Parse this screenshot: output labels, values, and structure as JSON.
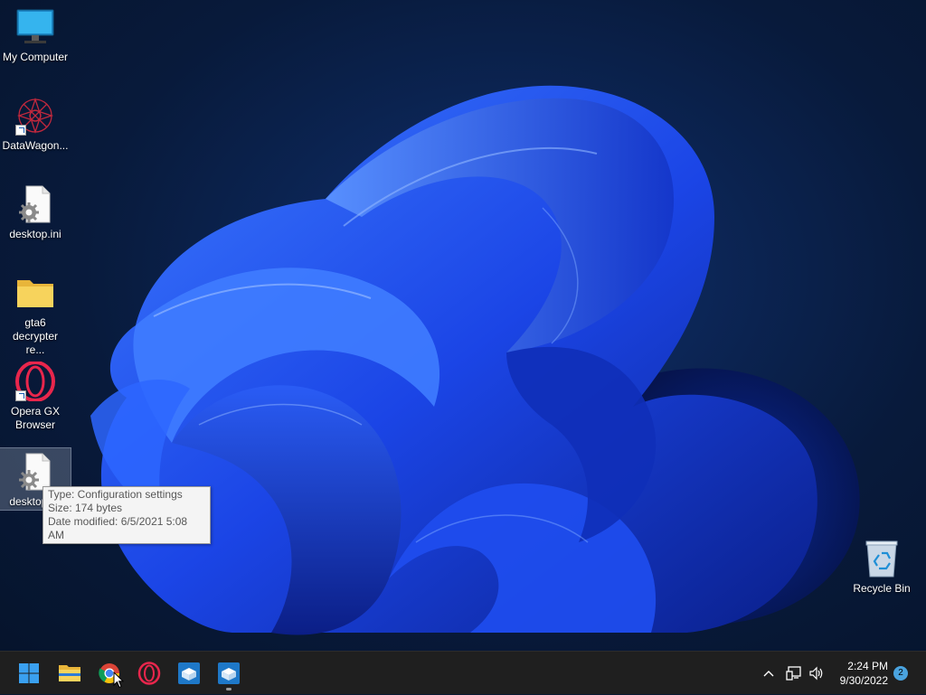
{
  "desktop": {
    "icons": [
      {
        "label": "My Computer",
        "icon": "monitor-icon"
      },
      {
        "label": "DataWagon...",
        "icon": "datawagon-icon",
        "shortcut": true
      },
      {
        "label": "desktop.ini",
        "icon": "settings-file-icon"
      },
      {
        "label": "gta6 decrypter re...",
        "icon": "folder-icon"
      },
      {
        "label": "Opera GX Browser",
        "icon": "opera-gx-icon",
        "shortcut": true
      },
      {
        "label": "desktop.ini",
        "icon": "settings-file-icon",
        "selected": true
      }
    ],
    "recycle_bin": {
      "label": "Recycle Bin",
      "icon": "recycle-bin-icon"
    }
  },
  "tooltip": {
    "type": "Type: Configuration settings",
    "size": "Size: 174 bytes",
    "date": "Date modified: 6/5/2021 5:08 AM"
  },
  "taskbar": {
    "pinned": [
      {
        "name": "start-button",
        "icon": "windows-logo-icon"
      },
      {
        "name": "file-explorer-button",
        "icon": "folder-icon"
      },
      {
        "name": "chrome-button",
        "icon": "chrome-icon"
      },
      {
        "name": "opera-gx-button",
        "icon": "opera-icon"
      },
      {
        "name": "app-box-button-1",
        "icon": "box-app-icon"
      },
      {
        "name": "app-box-button-2",
        "icon": "box-app-icon",
        "running": true
      }
    ],
    "tray": {
      "chevron": "show-hidden-icons",
      "time": "2:24 PM",
      "date": "9/30/2022",
      "notifications": "2"
    }
  },
  "colors": {
    "taskbar": "#1f1f1f",
    "accent": "#4aa3df",
    "wallpaper_blue": "#1846e0"
  }
}
